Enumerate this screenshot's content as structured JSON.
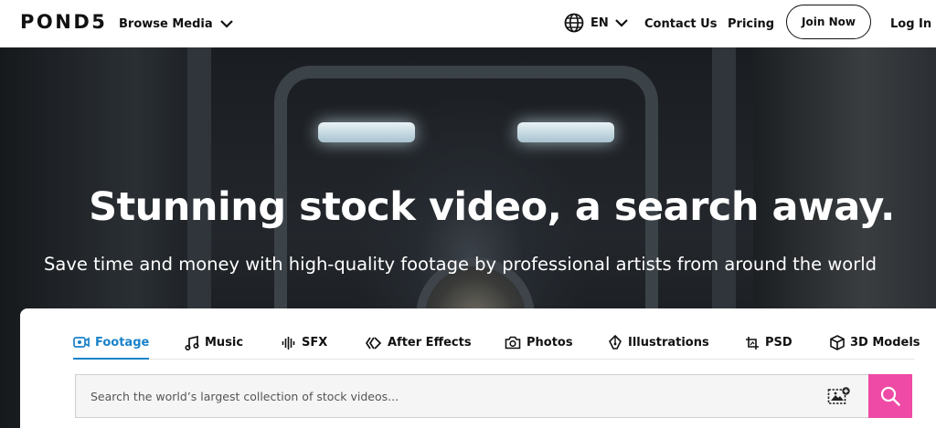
{
  "nav": {
    "logo": "POND5",
    "browse_label": "Browse Media",
    "language": "EN",
    "contact_label": "Contact Us",
    "pricing_label": "Pricing",
    "join_label": "Join Now",
    "login_label": "Log In"
  },
  "hero": {
    "headline": "Stunning stock video, a search away.",
    "subheadline": "Save time and money with high-quality footage by professional artists from around the world"
  },
  "search": {
    "tabs": [
      {
        "label": "Footage",
        "icon": "camera-icon",
        "active": true
      },
      {
        "label": "Music",
        "icon": "music-note-icon",
        "active": false
      },
      {
        "label": "SFX",
        "icon": "sound-wave-icon",
        "active": false
      },
      {
        "label": "After Effects",
        "icon": "after-effects-icon",
        "active": false
      },
      {
        "label": "Photos",
        "icon": "photo-camera-icon",
        "active": false
      },
      {
        "label": "Illustrations",
        "icon": "pen-nib-icon",
        "active": false
      },
      {
        "label": "PSD",
        "icon": "psd-crop-icon",
        "active": false
      },
      {
        "label": "3D Models",
        "icon": "cube-icon",
        "active": false
      }
    ],
    "placeholder": "Search the world’s largest collection of stock videos...",
    "value": ""
  },
  "colors": {
    "accent_blue": "#1a82c9",
    "search_button_pink": "#ee4aa6",
    "text_dark": "#111111"
  }
}
